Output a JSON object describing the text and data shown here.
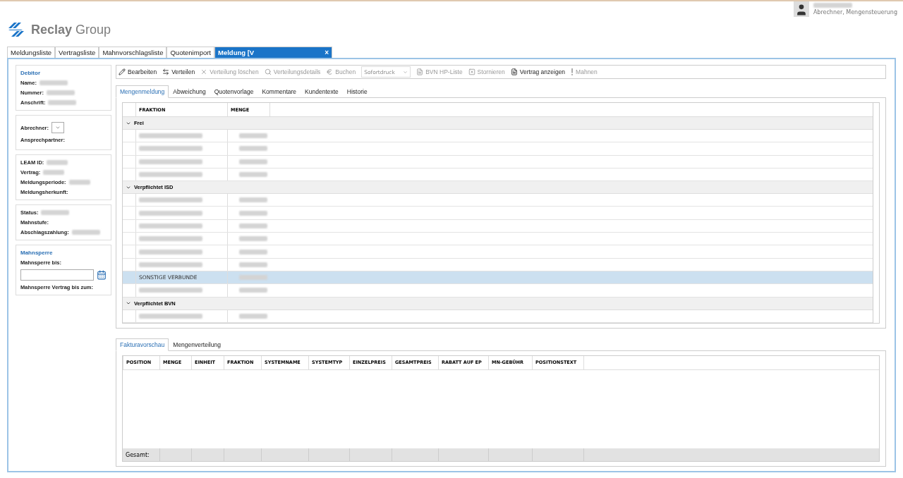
{
  "user": {
    "role": "Abrechner, Mengensteuerung"
  },
  "logo": {
    "bold": "Reclay",
    "light": "Group"
  },
  "tabs": [
    {
      "label": "Meldungsliste",
      "selected": false
    },
    {
      "label": "Vertragsliste",
      "selected": false
    },
    {
      "label": "Mahnvorschlagsliste",
      "selected": false
    },
    {
      "label": "Quotenimport",
      "selected": false
    },
    {
      "label": "Meldung [V",
      "selected": true,
      "close": "×"
    }
  ],
  "sidebar": [
    {
      "title": "Debitor",
      "fields": [
        {
          "label": "Name:",
          "kind": "text"
        },
        {
          "label": "Nummer:",
          "kind": "text"
        },
        {
          "label": "Anschrift:",
          "kind": "text"
        }
      ]
    },
    {
      "fields": [
        {
          "label": "Abrechner:",
          "kind": "dropdown"
        },
        {
          "label": "Ansprechpartner:",
          "kind": "label"
        }
      ]
    },
    {
      "fields": [
        {
          "label": "LEAM ID:",
          "kind": "text"
        },
        {
          "label": "Vertrag:",
          "kind": "text"
        },
        {
          "label": "Meldungsperiode:",
          "kind": "text"
        },
        {
          "label": "Meldungsherkunft:",
          "kind": "label"
        }
      ]
    },
    {
      "fields": [
        {
          "label": "Status:",
          "kind": "text"
        },
        {
          "label": "Mahnstufe:",
          "kind": "label"
        },
        {
          "label": "Abschlagszahlung:",
          "kind": "text"
        }
      ]
    },
    {
      "title": "Mahnsperre",
      "fields": [
        {
          "label": "Mahnsperre bis:",
          "kind": "date"
        },
        {
          "label": "Mahnsperre Vertrag bis zum:",
          "kind": "label"
        }
      ]
    }
  ],
  "toolbar": [
    {
      "kind": "button",
      "label": "Bearbeiten",
      "disabled": false
    },
    {
      "kind": "button",
      "label": "Verteilen",
      "disabled": false
    },
    {
      "kind": "button",
      "label": "Verteilung löschen",
      "disabled": true
    },
    {
      "kind": "button",
      "label": "Verteilungsdetails",
      "disabled": true
    },
    {
      "kind": "button",
      "label": "Buchen",
      "disabled": true
    },
    {
      "kind": "dropdown",
      "placeholder": "Sofortdruck",
      "disabled": true
    },
    {
      "kind": "button",
      "label": "BVN HP-Liste",
      "disabled": true
    },
    {
      "kind": "button",
      "label": "Stornieren",
      "disabled": true
    },
    {
      "kind": "button",
      "label": "Vertrag anzeigen",
      "disabled": false
    },
    {
      "kind": "button",
      "label": "Mahnen",
      "disabled": true
    }
  ],
  "detail_tabs": [
    {
      "label": "Mengenmeldung",
      "selected": true
    },
    {
      "label": "Abweichung",
      "selected": false
    },
    {
      "label": "Quotenvorlage",
      "selected": false
    },
    {
      "label": "Kommentare",
      "selected": false
    },
    {
      "label": "Kundentexte",
      "selected": false
    },
    {
      "label": "Historie",
      "selected": false
    }
  ],
  "grid": {
    "columns": [
      "FRAKTION",
      "MENGE"
    ],
    "groups": [
      {
        "name": "Frei",
        "expanded": true,
        "rows": [
          {
            "selected": false
          },
          {
            "selected": false
          },
          {
            "selected": false
          },
          {
            "selected": false
          }
        ]
      },
      {
        "name": "Verpflichtet ISD",
        "expanded": true,
        "rows": [
          {
            "selected": false
          },
          {
            "selected": false
          },
          {
            "selected": false
          },
          {
            "selected": false
          },
          {
            "selected": false
          },
          {
            "selected": false
          },
          {
            "fraktion": "SONSTIGE VERBUNDE",
            "selected": true
          },
          {
            "selected": false
          }
        ]
      },
      {
        "name": "Verpflichtet BVN",
        "expanded": true,
        "rows": [
          {
            "selected": false
          }
        ]
      }
    ]
  },
  "bottom_tabs": [
    {
      "label": "Fakturavorschau",
      "selected": true
    },
    {
      "label": "Mengenverteilung",
      "selected": false
    }
  ],
  "invoice": {
    "columns": [
      "POSITION",
      "MENGE",
      "EINHEIT",
      "FRAKTION",
      "SYSTEMNAME",
      "SYSTEMTYP",
      "EINZELPREIS",
      "GESAMTPREIS",
      "RABATT AUF EP",
      "MN-GEBÜHR",
      "POSITIONSTEXT"
    ],
    "total_label": "Gesamt:"
  }
}
